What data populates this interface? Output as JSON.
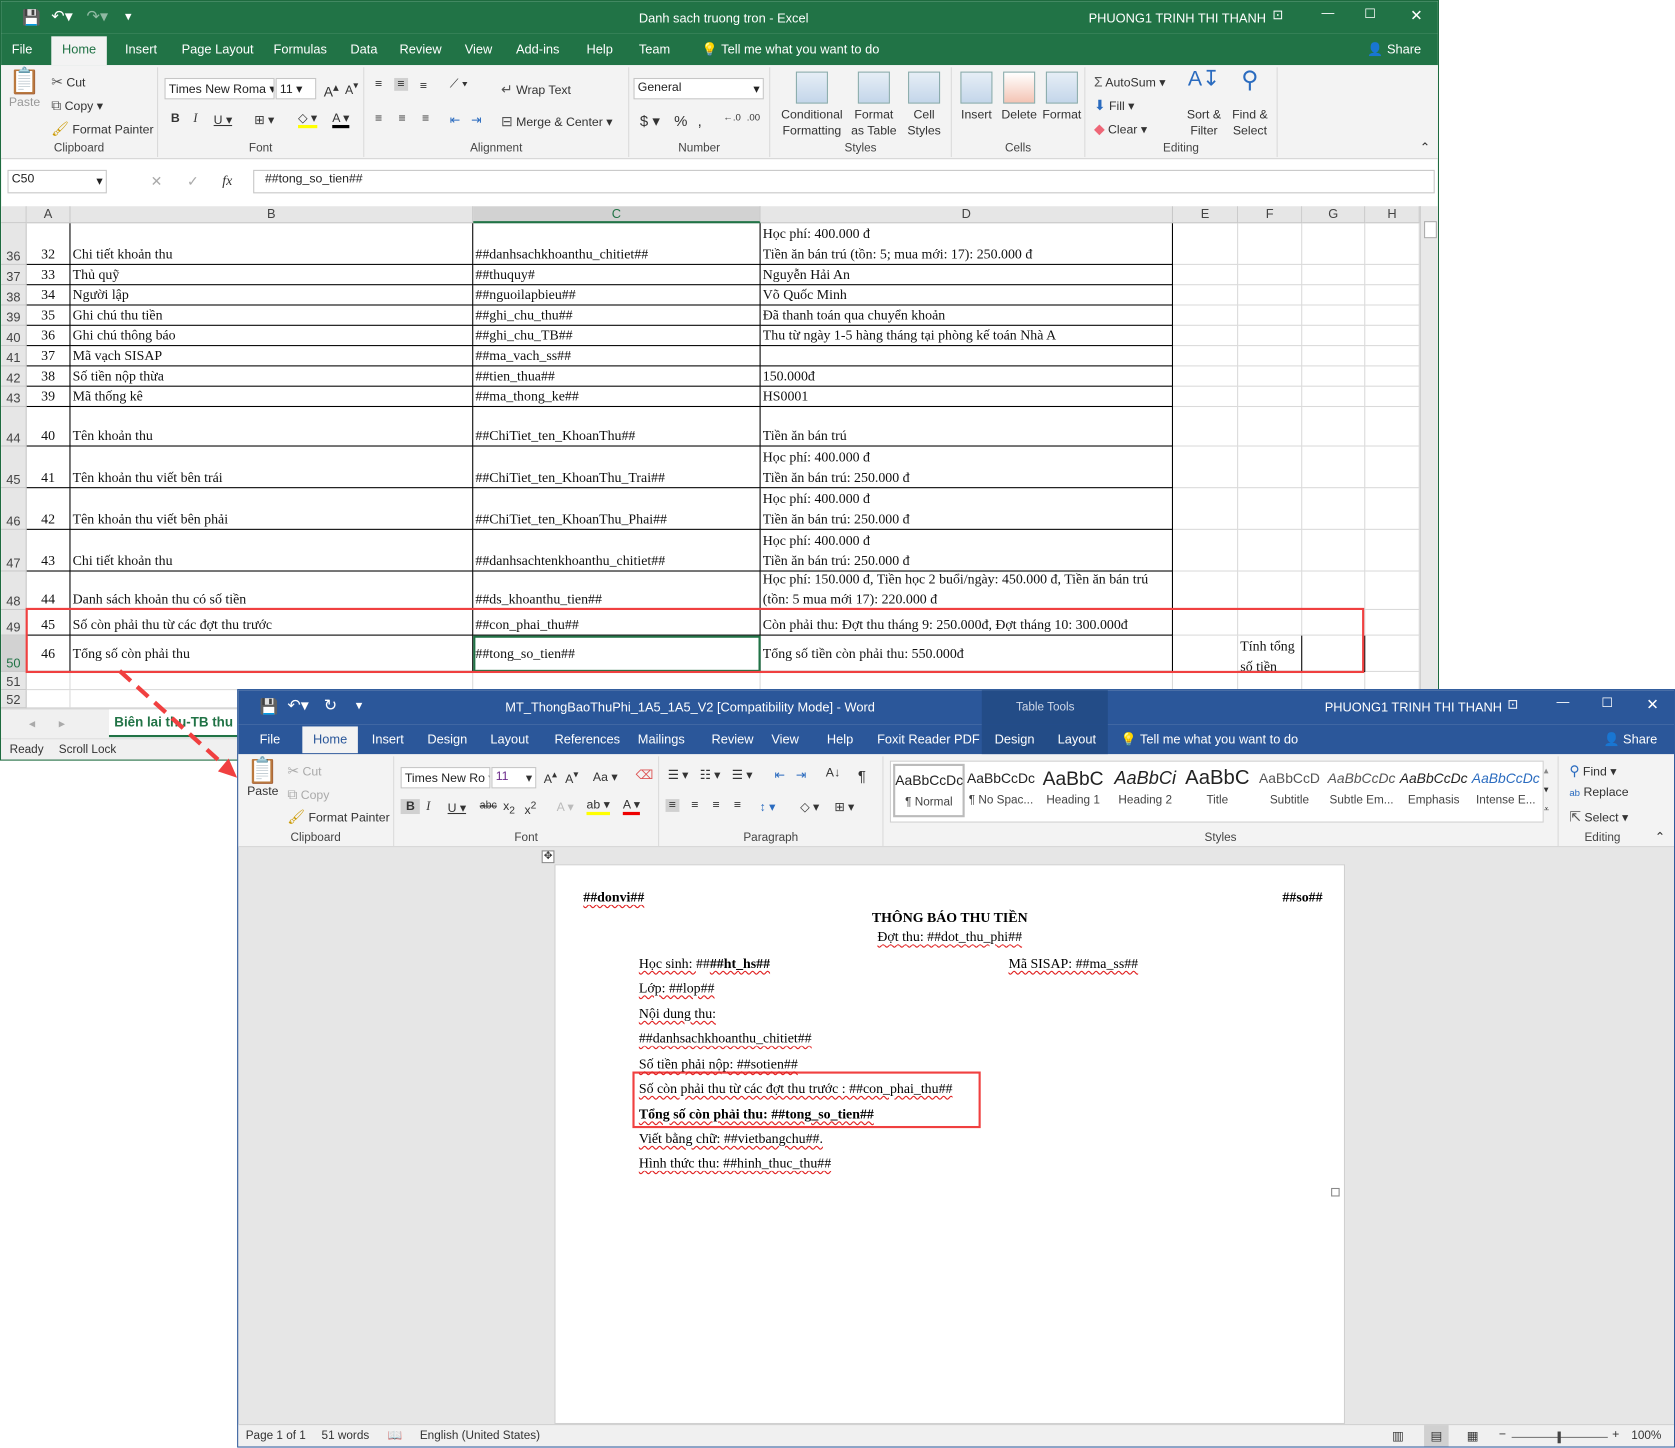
{
  "excel": {
    "title": "Danh sach truong tron  -  Excel",
    "user": "PHUONG1 TRINH THI THANH",
    "tabs": [
      "File",
      "Home",
      "Insert",
      "Page Layout",
      "Formulas",
      "Data",
      "Review",
      "View",
      "Add-ins",
      "Help",
      "Team"
    ],
    "tell_me": "Tell me what you want to do",
    "share": "Share",
    "clipboard": {
      "paste": "Paste",
      "cut": "Cut",
      "copy": "Copy",
      "format_painter": "Format Painter",
      "label": "Clipboard"
    },
    "font": {
      "name": "Times New Roma",
      "size": "11",
      "label": "Font"
    },
    "alignment": {
      "wrap": "Wrap Text",
      "merge": "Merge & Center",
      "label": "Alignment"
    },
    "number": {
      "format": "General",
      "label": "Number"
    },
    "styles": {
      "conditional": "Conditional Formatting",
      "format_table": "Format as Table",
      "cell_styles": "Cell Styles",
      "label": "Styles"
    },
    "cells": {
      "insert": "Insert",
      "delete": "Delete",
      "format": "Format",
      "label": "Cells"
    },
    "editing": {
      "autosum": "AutoSum",
      "fill": "Fill",
      "clear": "Clear",
      "sort": "Sort & Filter",
      "find": "Find & Select",
      "label": "Editing"
    },
    "name_box": "C50",
    "formula": "##tong_so_tien##",
    "columns": [
      "A",
      "B",
      "C",
      "D",
      "E",
      "F",
      "G",
      "H"
    ],
    "rows": [
      {
        "row": "36",
        "a": "32",
        "b": "Chi tiết khoản thu",
        "c": "##danhsachkhoanthu_chitiet##",
        "d": [
          "Học phí: 400.000 đ",
          "Tiền ăn bán trú (tồn: 5; mua mới: 17): 250.000 đ"
        ]
      },
      {
        "row": "37",
        "a": "33",
        "b": "Thủ quỹ",
        "c": "##thuquy#",
        "d": [
          "Nguyễn Hải An"
        ]
      },
      {
        "row": "38",
        "a": "34",
        "b": "Người lập",
        "c": "##nguoilapbieu##",
        "d": [
          "Võ Quốc Minh"
        ]
      },
      {
        "row": "39",
        "a": "35",
        "b": "Ghi chú thu tiền",
        "c": "##ghi_chu_thu##",
        "d": [
          "Đã thanh toán qua chuyển khoản"
        ]
      },
      {
        "row": "40",
        "a": "36",
        "b": "Ghi chú thông báo",
        "c": "##ghi_chu_TB##",
        "d": [
          "Thu từ ngày 1-5 hàng tháng tại phòng kế toán Nhà A"
        ]
      },
      {
        "row": "41",
        "a": "37",
        "b": "Mã vạch SISAP",
        "c": "##ma_vach_ss##",
        "d": []
      },
      {
        "row": "42",
        "a": "38",
        "b": "Số tiền nộp thừa",
        "c": "##tien_thua##",
        "d": [
          "150.000đ"
        ]
      },
      {
        "row": "43",
        "a": "39",
        "b": "Mã thống kê",
        "c": "##ma_thong_ke##",
        "d": [
          "HS0001"
        ]
      },
      {
        "row": "44",
        "a": "40",
        "b": "Tên khoản thu",
        "c": "##ChiTiet_ten_KhoanThu##",
        "d": [
          "Tiền ăn bán trú"
        ]
      },
      {
        "row": "45",
        "a": "41",
        "b": "Tên khoản thu viết bên trái",
        "c": "##ChiTiet_ten_KhoanThu_Trai##",
        "d": [
          "Học phí: 400.000 đ",
          "Tiền ăn bán trú: 250.000 đ"
        ]
      },
      {
        "row": "46",
        "a": "42",
        "b": "Tên khoản thu viết bên phải",
        "c": "##ChiTiet_ten_KhoanThu_Phai##",
        "d": [
          "Học phí: 400.000 đ",
          "Tiền ăn bán trú: 250.000 đ"
        ]
      },
      {
        "row": "47",
        "a": "43",
        "b": "Chi tiết khoản thu",
        "c": "##danhsachtenkhoanthu_chitiet##",
        "d": [
          "Học phí: 400.000 đ",
          "Tiền ăn bán trú: 250.000 đ"
        ]
      },
      {
        "row": "48",
        "a": "44",
        "b": "Danh sách khoản thu có số tiền",
        "c": "##ds_khoanthu_tien##",
        "d": [
          "Học phí: 150.000 đ, Tiền học 2 buổi/ngày: 450.000 đ, Tiền ăn bán trú",
          "(tồn: 5 mua mới 17): 220.000 đ"
        ]
      },
      {
        "row": "49",
        "a": "45",
        "b": "Số còn phải thu từ các đợt thu trước",
        "c": "##con_phai_thu##",
        "d": [
          "Còn phải thu: Đợt thu tháng 9: 250.000đ, Đợt tháng 10: 300.000đ"
        ]
      },
      {
        "row": "50",
        "a": "46",
        "b": "Tổng số còn phải thu",
        "c": "##tong_so_tien##",
        "d": [
          "Tổng số tiền còn phải thu: 550.000đ"
        ],
        "f": [
          "Tính tổng",
          "số tiền"
        ]
      },
      {
        "row": "51"
      },
      {
        "row": "52"
      }
    ],
    "sheet_tab": "Biên lai thu-TB thu phí",
    "status": [
      "Ready",
      "Scroll Lock"
    ]
  },
  "word": {
    "title": "MT_ThongBaoThuPhi_1A5_1A5_V2 [Compatibility Mode]  -  Word",
    "context": "Table Tools",
    "user": "PHUONG1 TRINH THI THANH",
    "tabs": [
      "File",
      "Home",
      "Insert",
      "Design",
      "Layout",
      "References",
      "Mailings",
      "Review",
      "View",
      "Help",
      "Foxit Reader PDF"
    ],
    "context_tabs": [
      "Design",
      "Layout"
    ],
    "tell_me": "Tell me what you want to do",
    "share": "Share",
    "clipboard": {
      "paste": "Paste",
      "cut": "Cut",
      "copy": "Copy",
      "format_painter": "Format Painter",
      "label": "Clipboard"
    },
    "font": {
      "name": "Times New Ro",
      "size": "11",
      "label": "Font"
    },
    "paragraph_label": "Paragraph",
    "styles": [
      {
        "preview": "AaBbCcDc",
        "name": "¶ Normal"
      },
      {
        "preview": "AaBbCcDc",
        "name": "¶ No Spac..."
      },
      {
        "preview": "AaBbC",
        "name": "Heading 1"
      },
      {
        "preview": "AaBbCi",
        "name": "Heading 2"
      },
      {
        "preview": "AaBbC",
        "name": "Title"
      },
      {
        "preview": "AaBbCcD",
        "name": "Subtitle"
      },
      {
        "preview": "AaBbCcDc",
        "name": "Subtle Em..."
      },
      {
        "preview": "AaBbCcDc",
        "name": "Emphasis"
      },
      {
        "preview": "AaBbCcDc",
        "name": "Intense E..."
      }
    ],
    "styles_label": "Styles",
    "editing": {
      "find": "Find",
      "replace": "Replace",
      "select": "Select",
      "label": "Editing"
    },
    "doc": {
      "donvi": "##donvi##",
      "so": "##so##",
      "heading": "THÔNG BÁO THU TIỀN",
      "dot_thu": "Đợt thu: ##dot_thu_phi##",
      "hoc_sinh_label": "Học sinh: ",
      "hoc_sinh_value": "##ht_hs##",
      "ma_sisap": "Mã SISAP: ##ma_ss##",
      "lines": [
        "Lớp:  ##lop##",
        "Nội dung thu:",
        " ##danhsachkhoanthu_chitiet##",
        "Số tiền phải nộp: ##sotien##",
        "Số còn phải thu từ các đợt thu trước : ##con_phai_thu##",
        "Tổng số còn phải thu: ##tong_so_tien##",
        "Viết bằng chữ: ##vietbangchu##.",
        "Hình thức thu: ##hinh_thuc_thu##"
      ]
    },
    "status": {
      "page": "Page 1 of 1",
      "words": "51 words",
      "language": "English (United States)",
      "zoom": "100%"
    }
  },
  "colors": {
    "excel_green": "#217346",
    "word_blue": "#2b579a",
    "highlight_red": "#f04040"
  }
}
